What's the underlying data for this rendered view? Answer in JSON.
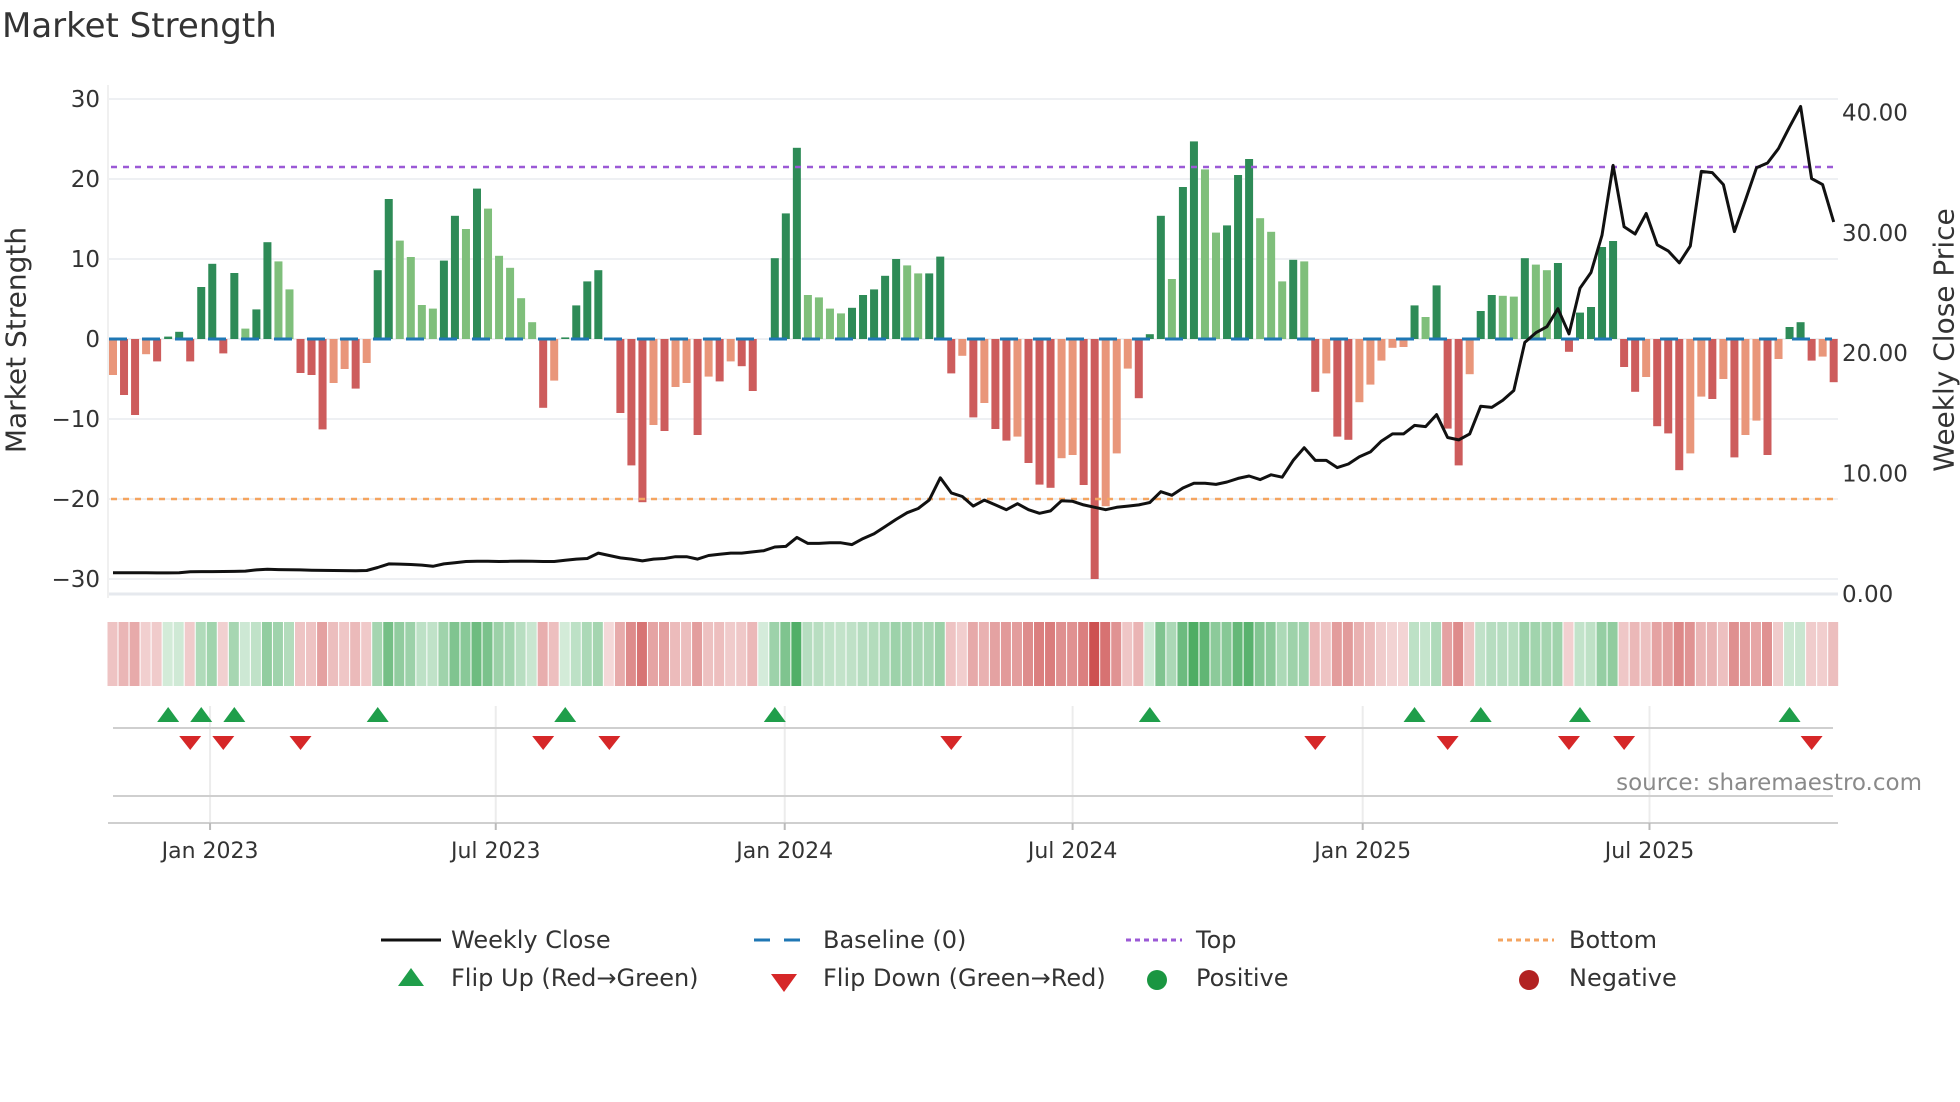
{
  "title": "Market Strength",
  "source": "source: sharemaestro.com",
  "legend": {
    "weekly_close": "Weekly Close",
    "baseline": "Baseline (0)",
    "top": "Top",
    "bottom": "Bottom",
    "flip_up": "Flip Up (Red→Green)",
    "flip_down": "Flip Down (Green→Red)",
    "positive": "Positive",
    "negative": "Negative"
  },
  "colors": {
    "rising_positive": "#2e8b57",
    "falling_positive": "#7fbf7b",
    "falling_negative": "#cd5c5c",
    "rising_negative": "#e9967a",
    "baseline": "#1f77b4",
    "top": "#9b59d6",
    "bottom": "#f4a460",
    "price": "#111111",
    "flip_up": "#1f9e4a",
    "flip_down": "#d62728",
    "positive": "#1a9641",
    "negative": "#b22222"
  },
  "chart_data": {
    "type": "bar+line",
    "title": "Market Strength",
    "ylabel": "Market Strength",
    "y2label": "Weekly Close Price",
    "ylim": [
      -32,
      32
    ],
    "y2lim": [
      -0.5,
      40.5
    ],
    "yticks": [
      "30",
      "20",
      "10",
      "0",
      "−10",
      "−20",
      "−30"
    ],
    "ytick_values": [
      30,
      20,
      10,
      0,
      -10,
      -20,
      -30
    ],
    "y2ticks": [
      "40.00",
      "30.00",
      "20.00",
      "10.00",
      "0.00"
    ],
    "y2tick_values": [
      40,
      30,
      20,
      10,
      0
    ],
    "top_threshold": 21.5,
    "bottom_threshold": -20,
    "baseline": 0,
    "xticks": [
      {
        "label": "Jan 2023",
        "week": 8.8
      },
      {
        "label": "Jul 2023",
        "week": 34.7
      },
      {
        "label": "Jan 2024",
        "week": 60.9
      },
      {
        "label": "Jul 2024",
        "week": 87.0
      },
      {
        "label": "Jan 2025",
        "week": 113.3
      },
      {
        "label": "Jul 2025",
        "week": 139.3
      }
    ],
    "strength": [
      -4.5,
      -7,
      -9.5,
      -1.9,
      -2.8,
      0.3,
      0.9,
      -2.8,
      6.5,
      9.4,
      -1.8,
      8.25,
      1.3,
      3.7,
      12.1,
      9.7,
      6.2,
      -4.25,
      -4.5,
      -11.3,
      -5.5,
      -3.75,
      -6.2,
      -3,
      8.6,
      17.5,
      12.3,
      10.25,
      4.25,
      3.8,
      9.8,
      15.4,
      13.75,
      18.8,
      16.3,
      10.4,
      8.9,
      5.1,
      2.1,
      -8.6,
      -5.2,
      0.2,
      4.2,
      7.2,
      8.6,
      -0.1,
      -9.25,
      -15.8,
      -20.4,
      -10.75,
      -11.5,
      -6,
      -5.5,
      -12,
      -4.7,
      -5.3,
      -2.8,
      -3.4,
      -6.5,
      0,
      10.1,
      15.7,
      23.9,
      5.5,
      5.2,
      3.8,
      3.2,
      3.9,
      5.5,
      6.2,
      7.9,
      10,
      9.2,
      8.2,
      8.2,
      10.3,
      -4.3,
      -2.1,
      -9.8,
      -8,
      -11.25,
      -12.7,
      -12.2,
      -15.5,
      -18.2,
      -18.6,
      -14.9,
      -14.5,
      -18.25,
      -30,
      -20.9,
      -14.3,
      -3.7,
      -7.4,
      0.6,
      15.4,
      7.5,
      19,
      24.7,
      21.2,
      13.3,
      14.2,
      20.5,
      22.5,
      15.1,
      13.4,
      7.2,
      9.9,
      9.7,
      -6.6,
      -4.3,
      -12.2,
      -12.6,
      -7.9,
      -5.7,
      -2.7,
      -1.1,
      -1,
      4.2,
      2.75,
      6.7,
      -11.2,
      -15.8,
      -4.4,
      3.5,
      5.5,
      5.4,
      5.3,
      10.1,
      9.3,
      8.6,
      9.5,
      -1.6,
      3.3,
      4,
      11.5,
      12.25,
      -3.5,
      -6.6,
      -4.75,
      -10.9,
      -11.8,
      -16.4,
      -14.3,
      -7.2,
      -7.5,
      -5,
      -14.8,
      -12,
      -10.2,
      -14.5,
      -2.5,
      1.5,
      2.1,
      -2.7,
      -2.2,
      -5.4
    ],
    "weekly_close": [
      1.77,
      1.77,
      1.76,
      1.76,
      1.75,
      1.75,
      1.76,
      1.85,
      1.86,
      1.86,
      1.87,
      1.88,
      1.9,
      2.0,
      2.05,
      2.03,
      2.02,
      2.0,
      1.98,
      1.96,
      1.95,
      1.94,
      1.93,
      1.95,
      2.2,
      2.5,
      2.48,
      2.45,
      2.4,
      2.3,
      2.5,
      2.6,
      2.7,
      2.72,
      2.72,
      2.7,
      2.72,
      2.73,
      2.72,
      2.7,
      2.7,
      2.8,
      2.9,
      2.95,
      3.4,
      3.2,
      3.0,
      2.9,
      2.75,
      2.9,
      2.95,
      3.1,
      3.1,
      2.9,
      3.2,
      3.3,
      3.4,
      3.4,
      3.5,
      3.6,
      3.9,
      3.95,
      4.7,
      4.2,
      4.2,
      4.25,
      4.25,
      4.1,
      4.6,
      5.0,
      5.6,
      6.2,
      6.75,
      7.1,
      7.8,
      9.65,
      8.4,
      8.1,
      7.3,
      7.8,
      7.4,
      7.0,
      7.5,
      7.0,
      6.7,
      6.9,
      7.75,
      7.7,
      7.4,
      7.2,
      7.0,
      7.2,
      7.3,
      7.4,
      7.6,
      8.5,
      8.2,
      8.8,
      9.2,
      9.2,
      9.1,
      9.3,
      9.6,
      9.8,
      9.5,
      9.9,
      9.7,
      11.1,
      12.15,
      11.1,
      11.1,
      10.5,
      10.8,
      11.4,
      11.8,
      12.7,
      13.3,
      13.3,
      14.0,
      13.9,
      14.9,
      13.0,
      12.8,
      13.3,
      15.6,
      15.5,
      16.1,
      16.9,
      20.9,
      21.7,
      22.2,
      23.7,
      21.6,
      25.4,
      26.7,
      29.8,
      35.6,
      30.5,
      29.9,
      31.6,
      29.0,
      28.5,
      27.5,
      28.9,
      35.1,
      35.0,
      34.0,
      30.1,
      32.7,
      35.4,
      35.8,
      37.0,
      38.8,
      40.5,
      34.5,
      34.0,
      30.9
    ],
    "flip_up_weeks": [
      5,
      8,
      11,
      24,
      41,
      60,
      94,
      118,
      124,
      133,
      152
    ],
    "flip_down_weeks": [
      7,
      10,
      17,
      39,
      45,
      76,
      109,
      121,
      132,
      137,
      154
    ],
    "legend_placement": "bottom-center"
  }
}
